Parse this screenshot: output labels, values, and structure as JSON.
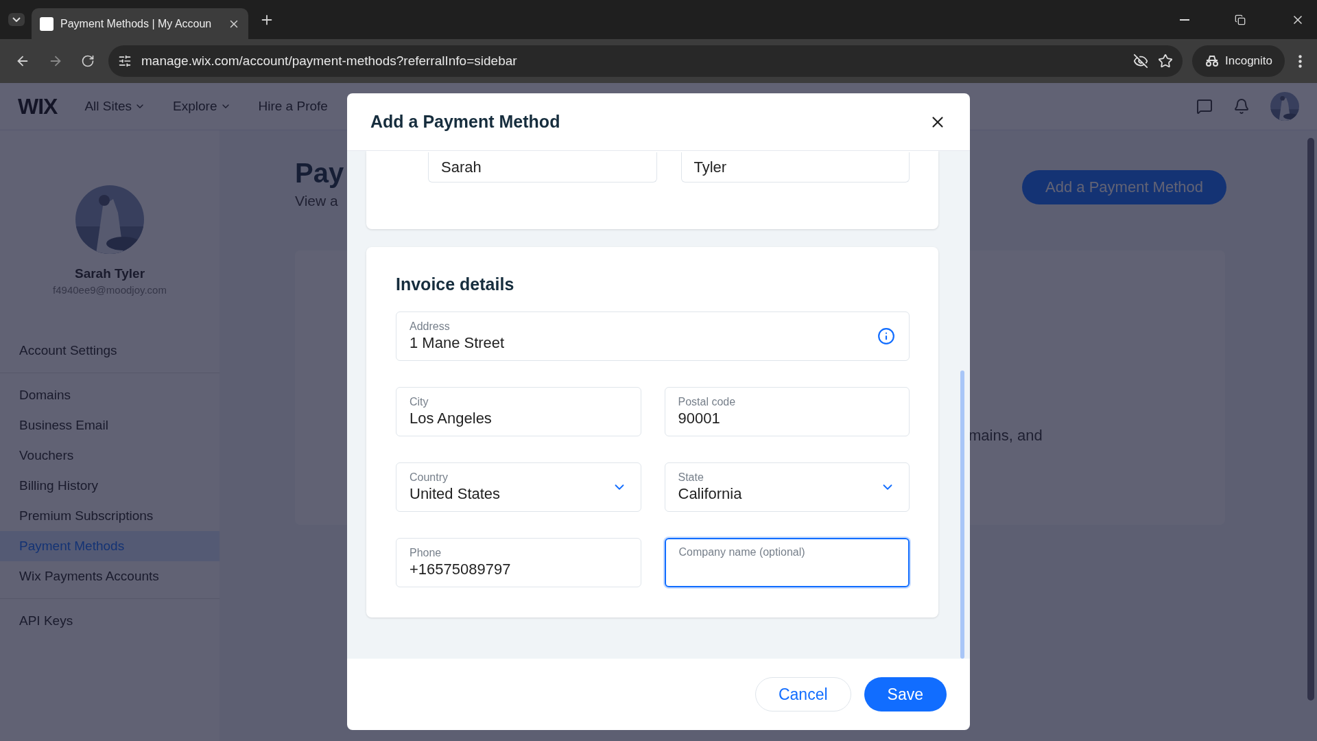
{
  "browser": {
    "tab_title": "Payment Methods | My Accoun",
    "url": "manage.wix.com/account/payment-methods?referralInfo=sidebar",
    "profile": "Incognito"
  },
  "header": {
    "logo": "WIX",
    "nav": [
      {
        "label": "All Sites",
        "dropdown": true
      },
      {
        "label": "Explore",
        "dropdown": true
      },
      {
        "label": "Hire a Profe",
        "dropdown": false
      }
    ]
  },
  "sidebar": {
    "name": "Sarah Tyler",
    "email": "f4940ee9@moodjoy.com",
    "groups": [
      [
        {
          "label": "Account Settings",
          "selected": false
        }
      ],
      [
        {
          "label": "Domains",
          "selected": false
        },
        {
          "label": "Business Email",
          "selected": false
        },
        {
          "label": "Vouchers",
          "selected": false
        },
        {
          "label": "Billing History",
          "selected": false
        },
        {
          "label": "Premium Subscriptions",
          "selected": false
        },
        {
          "label": "Payment Methods",
          "selected": true
        },
        {
          "label": "Wix Payments Accounts",
          "selected": false
        }
      ],
      [
        {
          "label": "API Keys",
          "selected": false
        }
      ]
    ]
  },
  "main": {
    "title": "Pay",
    "subtitle": "View a",
    "add_button": "Add a Payment Method",
    "body_text": "mains, and"
  },
  "dialog": {
    "title": "Add a Payment Method",
    "name_fields": [
      {
        "value": "Sarah"
      },
      {
        "value": "Tyler"
      }
    ],
    "invoice_title": "Invoice details",
    "fields": [
      {
        "kind": "info",
        "label": "Address",
        "value": "1 Mane Street",
        "focused": false
      },
      {
        "kind": "text",
        "label": "City",
        "value": "Los Angeles",
        "focused": false
      },
      {
        "kind": "text",
        "label": "Postal code",
        "value": "90001",
        "focused": false
      },
      {
        "kind": "select",
        "label": "Country",
        "value": "United States",
        "focused": false
      },
      {
        "kind": "select",
        "label": "State",
        "value": "California",
        "focused": false
      },
      {
        "kind": "text",
        "label": "Phone",
        "value": "+16575089797",
        "focused": false
      },
      {
        "kind": "text",
        "label": "Company name (optional)",
        "focused": true
      }
    ],
    "buttons": {
      "cancel": "Cancel",
      "save": "Save"
    }
  }
}
